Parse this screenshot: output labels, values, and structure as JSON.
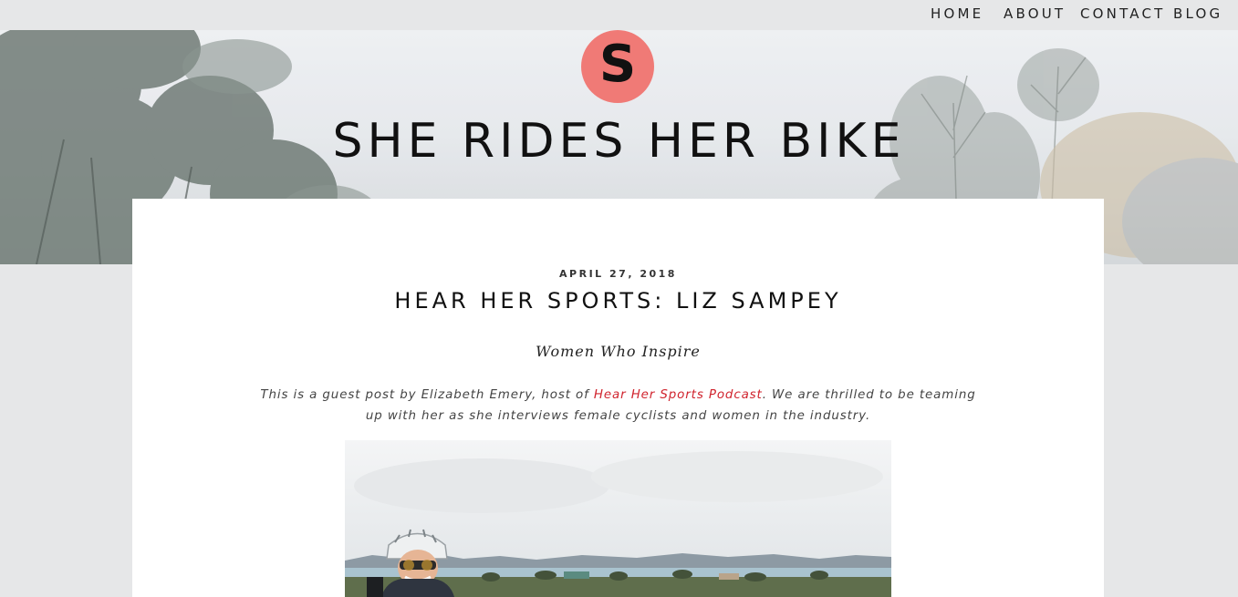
{
  "nav": {
    "items": [
      {
        "label": "HOME"
      },
      {
        "label": "ABOUT"
      },
      {
        "label": "CONTACT"
      },
      {
        "label": "BLOG"
      }
    ]
  },
  "header": {
    "logo_letter": "S",
    "site_title": "SHE RIDES HER BIKE"
  },
  "post": {
    "date": "APRIL 27, 2018",
    "title": "HEAR HER SPORTS: LIZ SAMPEY",
    "subtitle": "Women Who Inspire",
    "intro_before": "This is a guest post by Elizabeth Emery, host of ",
    "intro_link": "Hear Her Sports Podcast",
    "intro_after": ". We are thrilled to be teaming up with her as she interviews female cyclists and women in the industry."
  },
  "colors": {
    "accent": "#f07a76",
    "link": "#d0232d",
    "background": "#e6e7e8"
  }
}
